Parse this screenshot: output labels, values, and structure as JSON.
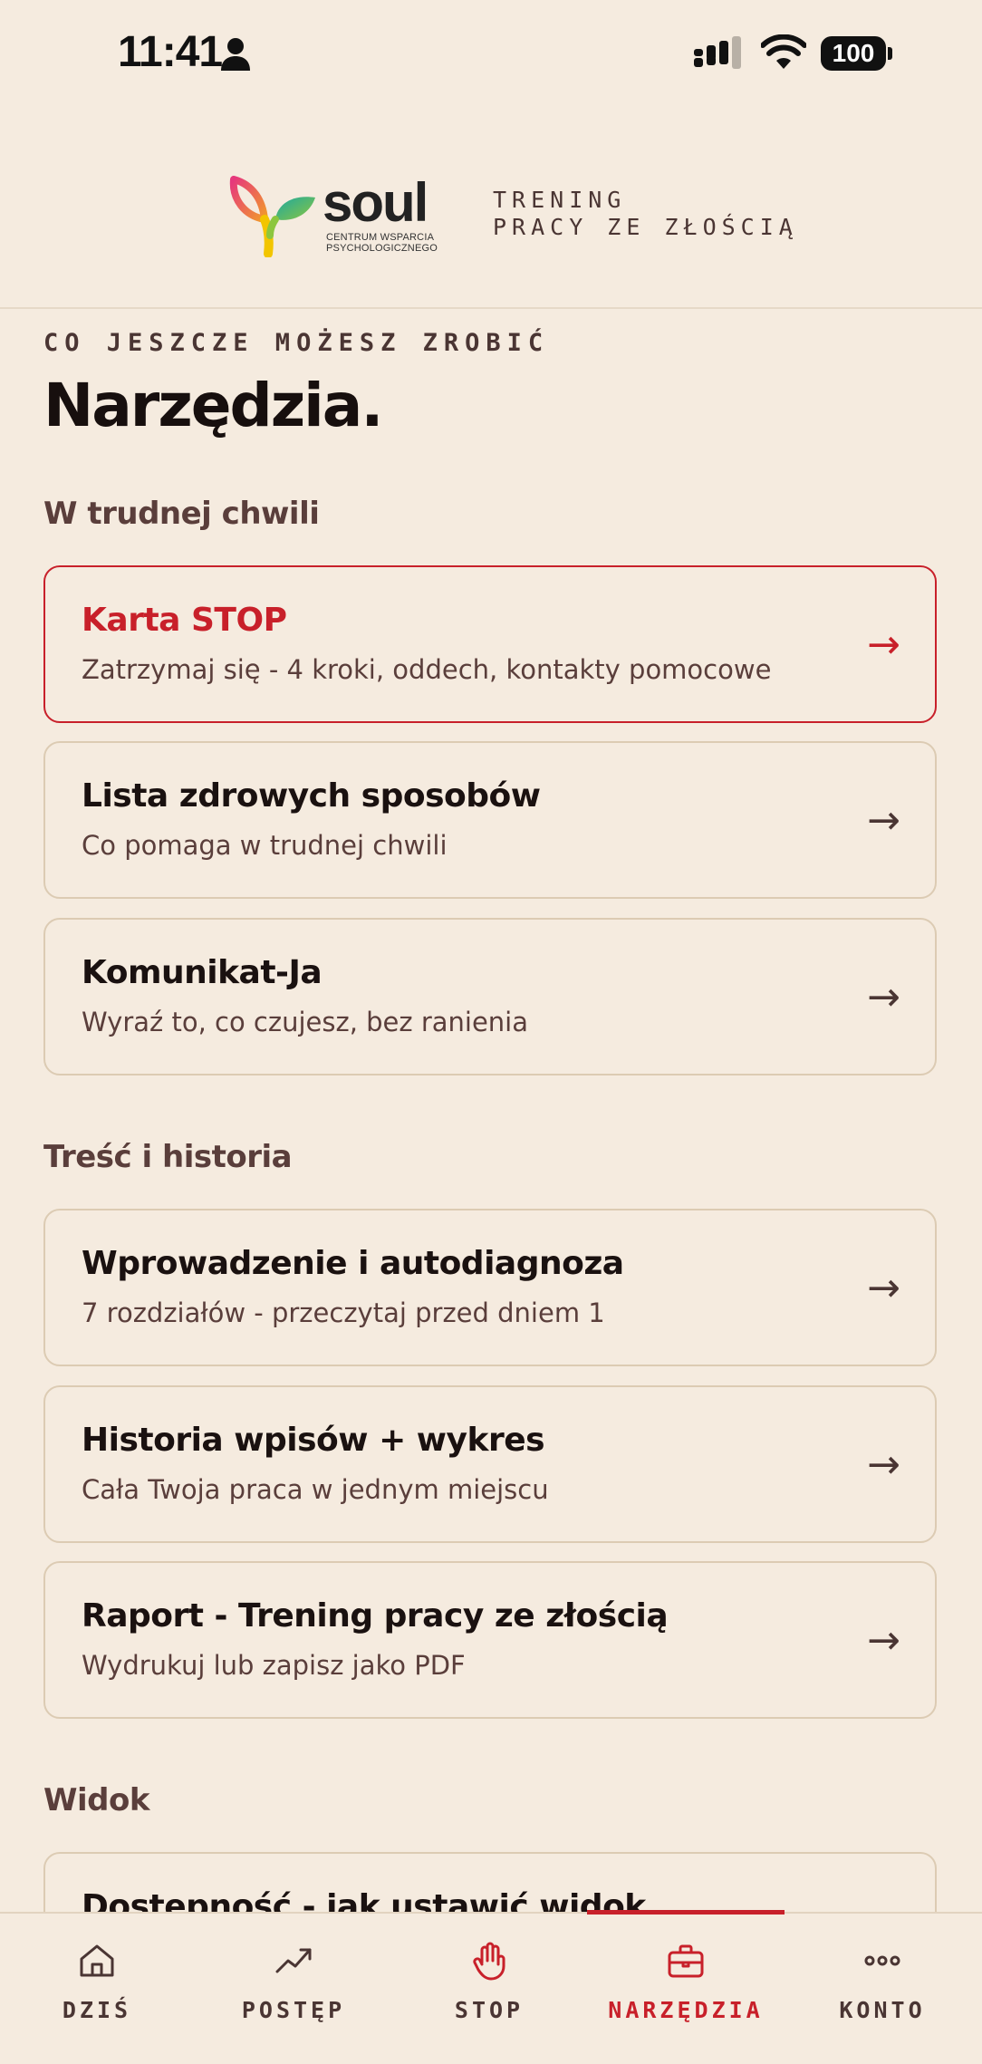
{
  "status_bar": {
    "time": "11:41",
    "battery": "100",
    "icons": [
      "person-icon",
      "signal-icon",
      "wifi-icon",
      "battery-icon"
    ]
  },
  "header": {
    "logo_word": "soul",
    "logo_sub": "CENTRUM WSPARCIA PSYCHOLOGICZNEGO",
    "title": "TRENING\nPRACY ZE ZŁOŚCIĄ"
  },
  "page": {
    "eyebrow": "CO JESZCZE MOŻESZ ZROBIĆ",
    "title": "Narzędzia."
  },
  "sections": [
    {
      "title": "W trudnej chwili",
      "cards": [
        {
          "title": "Karta STOP",
          "subtitle": "Zatrzymaj się - 4 kroki, oddech, kontakty pomocowe",
          "arrow": "→",
          "accent": "#c8202a"
        },
        {
          "title": "Lista zdrowych sposobów",
          "subtitle": "Co pomaga w trudnej chwili",
          "arrow": "→"
        },
        {
          "title": "Komunikat-Ja",
          "subtitle": "Wyraź to, co czujesz, bez ranienia",
          "arrow": "→"
        }
      ]
    },
    {
      "title": "Treść i historia",
      "cards": [
        {
          "title": "Wprowadzenie i autodiagnoza",
          "subtitle": "7 rozdziałów - przeczytaj przed dniem 1",
          "arrow": "→"
        },
        {
          "title": "Historia wpisów + wykres",
          "subtitle": "Cała Twoja praca w jednym miejscu",
          "arrow": "→"
        },
        {
          "title": "Raport - Trening pracy ze złością",
          "subtitle": "Wydrukuj lub zapisz jako PDF",
          "arrow": "→"
        }
      ]
    },
    {
      "title": "Widok",
      "cards": [
        {
          "title": "Dostępność - jak ustawić widok",
          "subtitle": "",
          "arrow": ""
        }
      ]
    }
  ],
  "bottom_nav": {
    "active": "NARZĘDZIA",
    "accent": "#c8202a",
    "items": [
      {
        "label": "DZIŚ",
        "icon": "home-icon"
      },
      {
        "label": "POSTĘP",
        "icon": "trend-icon"
      },
      {
        "label": "STOP",
        "icon": "hand-icon"
      },
      {
        "label": "NARZĘDZIA",
        "icon": "toolbox-icon"
      },
      {
        "label": "KONTO",
        "icon": "more-icon"
      }
    ]
  }
}
